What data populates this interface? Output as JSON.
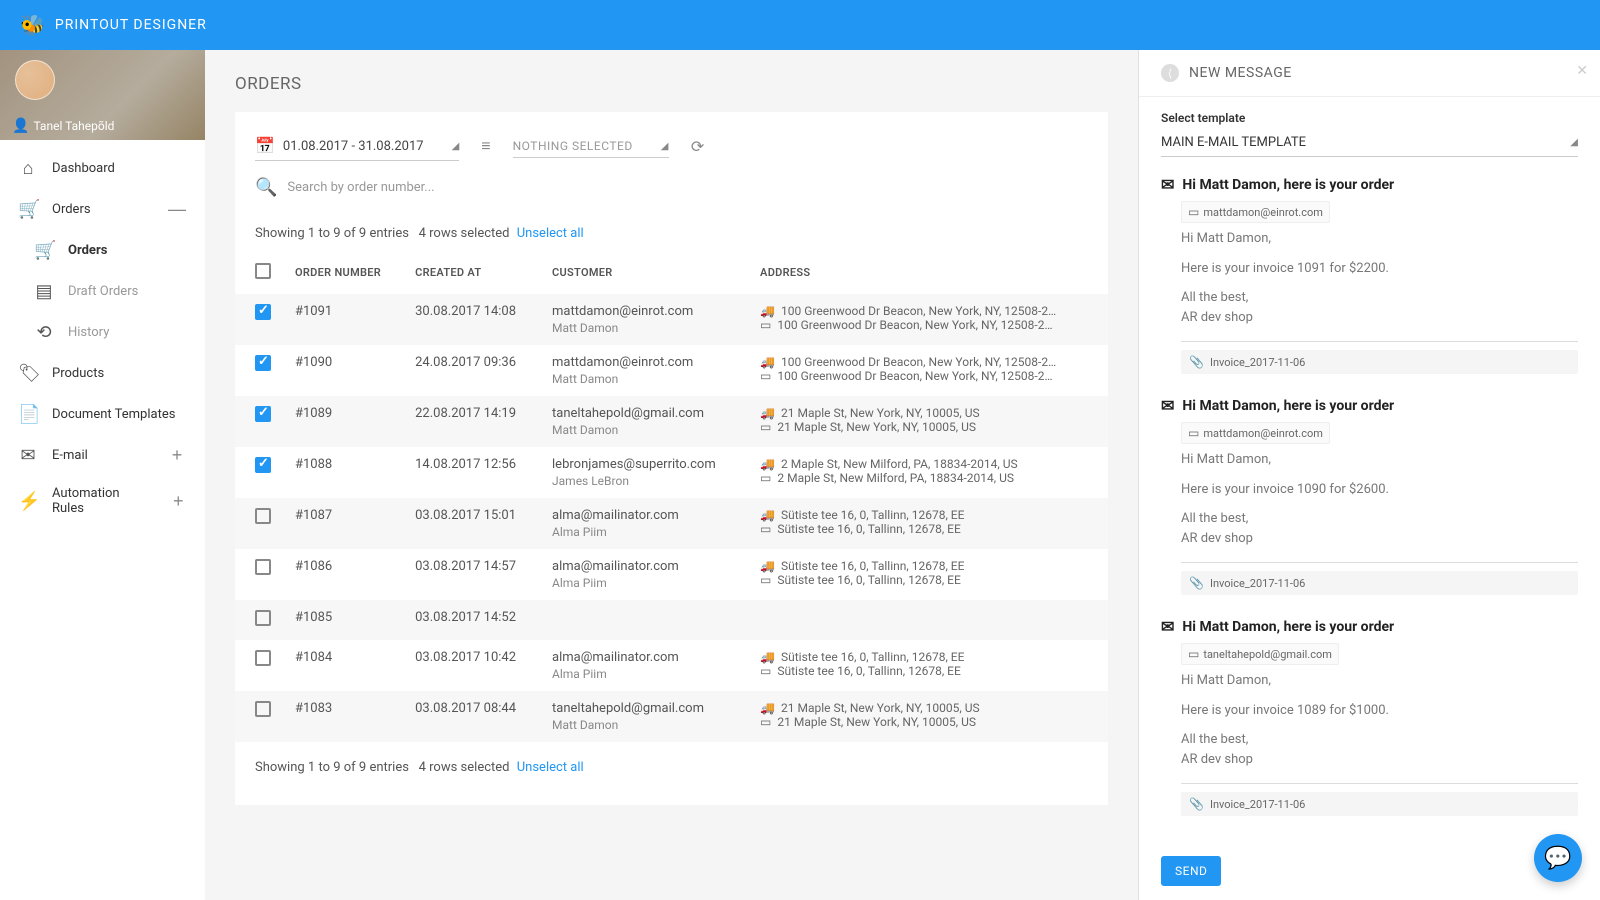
{
  "brand": "PRINTOUT DESIGNER",
  "user_name": "Tanel Tahepõld",
  "nav": {
    "dashboard": "Dashboard",
    "orders": "Orders",
    "orders_sub": "Orders",
    "draft_orders": "Draft Orders",
    "history": "History",
    "products": "Products",
    "doc_templates": "Document Templates",
    "email": "E-mail",
    "automation": "Automation Rules"
  },
  "page_title": "ORDERS",
  "filters": {
    "date_range": "01.08.2017 - 31.08.2017",
    "nothing": "NOTHING SELECTED"
  },
  "search_placeholder": "Search by order number...",
  "summary": {
    "showing": "Showing 1 to 9 of 9 entries",
    "selected": "4 rows selected",
    "unselect": "Unselect all"
  },
  "columns": {
    "order_number": "ORDER NUMBER",
    "created_at": "CREATED AT",
    "customer": "CUSTOMER",
    "address": "ADDRESS"
  },
  "rows": [
    {
      "checked": true,
      "num": "#1091",
      "created": "30.08.2017 14:08",
      "email": "mattdamon@einrot.com",
      "name": "Matt Damon",
      "ship": "100 Greenwood Dr Beacon, New York, NY, 12508-2…",
      "bill": "100 Greenwood Dr Beacon, New York, NY, 12508-2…"
    },
    {
      "checked": true,
      "num": "#1090",
      "created": "24.08.2017 09:36",
      "email": "mattdamon@einrot.com",
      "name": "Matt Damon",
      "ship": "100 Greenwood Dr Beacon, New York, NY, 12508-2…",
      "bill": "100 Greenwood Dr Beacon, New York, NY, 12508-2…"
    },
    {
      "checked": true,
      "num": "#1089",
      "created": "22.08.2017 14:19",
      "email": "taneltahepold@gmail.com",
      "name": "Matt Damon",
      "ship": "21 Maple St, New York, NY, 10005, US",
      "bill": "21 Maple St, New York, NY, 10005, US"
    },
    {
      "checked": true,
      "num": "#1088",
      "created": "14.08.2017 12:56",
      "email": "lebronjames@superrito.com",
      "name": "James LeBron",
      "ship": "2 Maple St, New Milford, PA, 18834-2014, US",
      "bill": "2 Maple St, New Milford, PA, 18834-2014, US"
    },
    {
      "checked": false,
      "num": "#1087",
      "created": "03.08.2017 15:01",
      "email": "alma@mailinator.com",
      "name": "Alma Piim",
      "ship": "Sütiste tee 16, 0, Tallinn, 12678, EE",
      "bill": "Sütiste tee 16, 0, Tallinn, 12678, EE"
    },
    {
      "checked": false,
      "num": "#1086",
      "created": "03.08.2017 14:57",
      "email": "alma@mailinator.com",
      "name": "Alma Piim",
      "ship": "Sütiste tee 16, 0, Tallinn, 12678, EE",
      "bill": "Sütiste tee 16, 0, Tallinn, 12678, EE"
    },
    {
      "checked": false,
      "num": "#1085",
      "created": "03.08.2017 14:52",
      "email": "",
      "name": "",
      "ship": "",
      "bill": ""
    },
    {
      "checked": false,
      "num": "#1084",
      "created": "03.08.2017 10:42",
      "email": "alma@mailinator.com",
      "name": "Alma Piim",
      "ship": "Sütiste tee 16, 0, Tallinn, 12678, EE",
      "bill": "Sütiste tee 16, 0, Tallinn, 12678, EE"
    },
    {
      "checked": false,
      "num": "#1083",
      "created": "03.08.2017 08:44",
      "email": "taneltahepold@gmail.com",
      "name": "Matt Damon",
      "ship": "21 Maple St, New York, NY, 10005, US",
      "bill": "21 Maple St, New York, NY, 10005, US"
    }
  ],
  "compose": {
    "title": "NEW MESSAGE",
    "select_label": "Select template",
    "template": "MAIN E-MAIL TEMPLATE",
    "send": "SEND",
    "messages": [
      {
        "subject": "Hi Matt Damon, here is your order",
        "to": "mattdamon@einrot.com",
        "greeting": "Hi Matt Damon,",
        "line": "Here is your invoice 1091 for $2200.",
        "sig1": "All the best,",
        "sig2": "AR dev shop",
        "attach": "Invoice_2017-11-06"
      },
      {
        "subject": "Hi Matt Damon, here is your order",
        "to": "mattdamon@einrot.com",
        "greeting": "Hi Matt Damon,",
        "line": "Here is your invoice 1090 for $2600.",
        "sig1": "All the best,",
        "sig2": "AR dev shop",
        "attach": "Invoice_2017-11-06"
      },
      {
        "subject": "Hi Matt Damon, here is your order",
        "to": "taneltahepold@gmail.com",
        "greeting": "Hi Matt Damon,",
        "line": "Here is your invoice 1089 for $1000.",
        "sig1": "All the best,",
        "sig2": "AR dev shop",
        "attach": "Invoice_2017-11-06"
      }
    ]
  }
}
